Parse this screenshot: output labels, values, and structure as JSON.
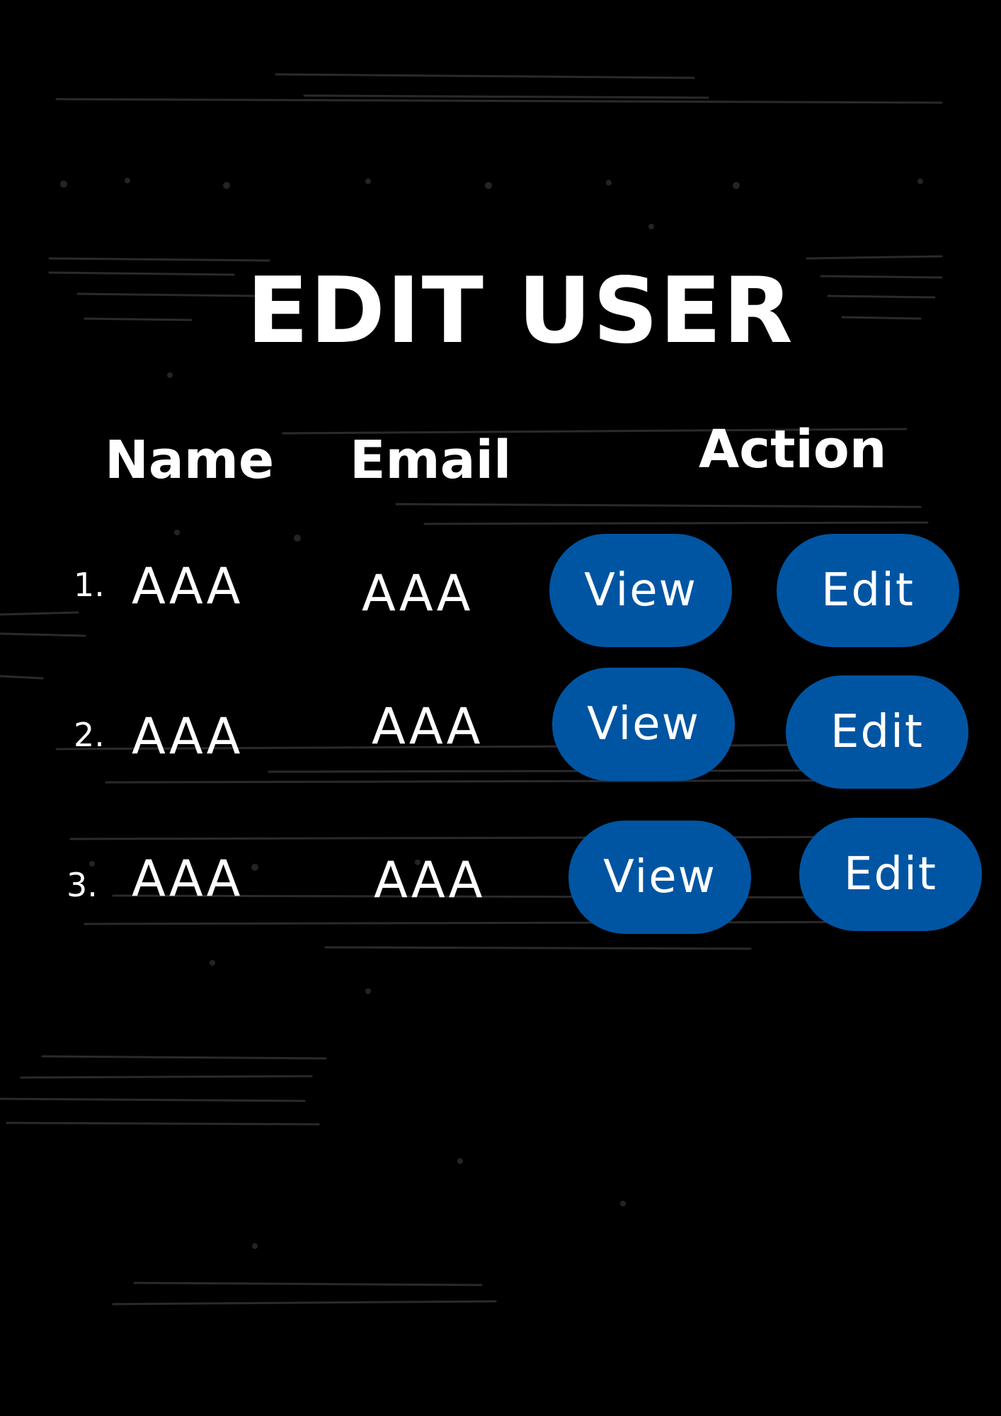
{
  "page": {
    "title": "EDIT USER",
    "background_color": "#000000",
    "button_color": "#0055a3",
    "text_color": "#ffffff"
  },
  "table": {
    "headers": {
      "name": "Name",
      "email": "Email",
      "action": "Action"
    },
    "rows": [
      {
        "number": "1.",
        "name": "AAA",
        "email": "AAA",
        "view_label": "View",
        "edit_label": "Edit"
      },
      {
        "number": "2.",
        "name": "AAA",
        "email": "AAA",
        "view_label": "View",
        "edit_label": "Edit"
      },
      {
        "number": "3.",
        "name": "AAA",
        "email": "AAA",
        "view_label": "View",
        "edit_label": "Edit"
      }
    ]
  }
}
